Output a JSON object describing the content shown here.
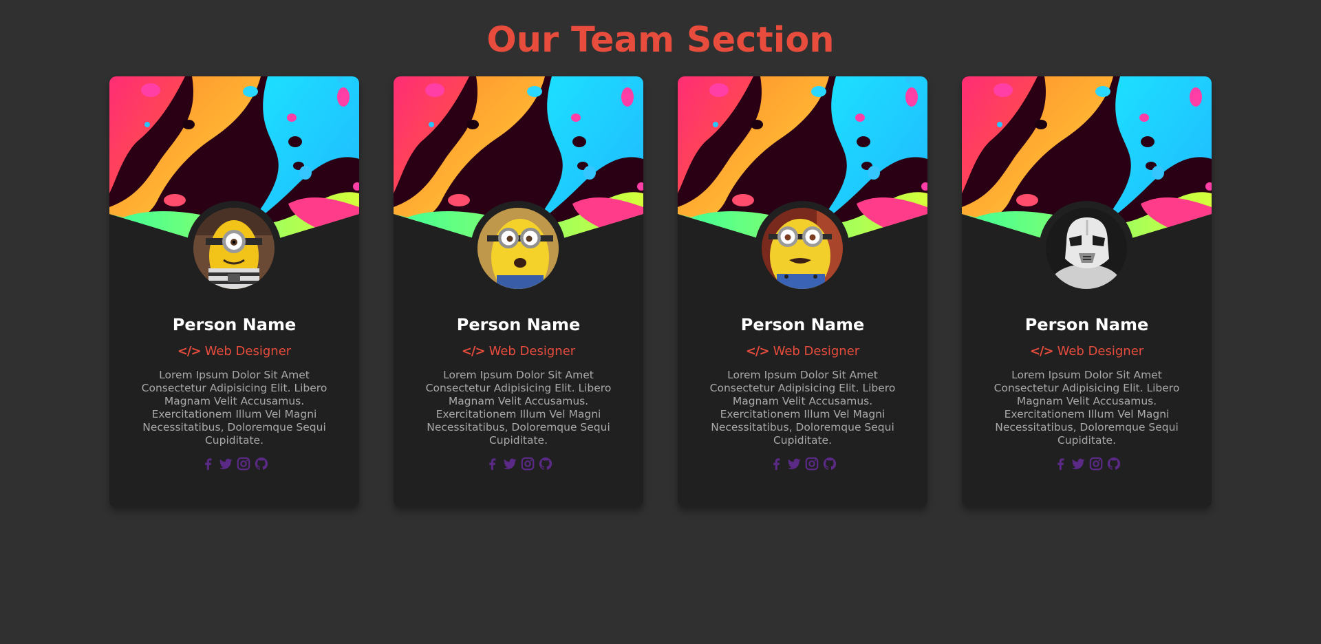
{
  "page": {
    "title": "Our Team Section"
  },
  "colors": {
    "background": "#303030",
    "card_background": "#202020",
    "accent": "#e74c3c",
    "social_icon": "#5b2a86",
    "name_text": "#ffffff",
    "bio_text": "#a9a9a9"
  },
  "cards": [
    {
      "name": "Person Name",
      "role": "Web Designer",
      "role_icon": "code-icon",
      "bio": "Lorem Ipsum Dolor Sit Amet Consectetur Adipisicing Elit. Libero Magnam Velit Accusamus. Exercitationem Illum Vel Magni Necessitatibus, Doloremque Sequi Cupiditate.",
      "avatar": "minion-one-eye-avatar",
      "socials": [
        "facebook-icon",
        "twitter-icon",
        "instagram-icon",
        "github-icon"
      ]
    },
    {
      "name": "Person Name",
      "role": "Web Designer",
      "role_icon": "code-icon",
      "bio": "Lorem Ipsum Dolor Sit Amet Consectetur Adipisicing Elit. Libero Magnam Velit Accusamus. Exercitationem Illum Vel Magni Necessitatibus, Doloremque Sequi Cupiditate.",
      "avatar": "minion-two-eyes-avatar",
      "socials": [
        "facebook-icon",
        "twitter-icon",
        "instagram-icon",
        "github-icon"
      ]
    },
    {
      "name": "Person Name",
      "role": "Web Designer",
      "role_icon": "code-icon",
      "bio": "Lorem Ipsum Dolor Sit Amet Consectetur Adipisicing Elit. Libero Magnam Velit Accusamus. Exercitationem Illum Vel Magni Necessitatibus, Doloremque Sequi Cupiditate.",
      "avatar": "minion-surprised-avatar",
      "socials": [
        "facebook-icon",
        "twitter-icon",
        "instagram-icon",
        "github-icon"
      ]
    },
    {
      "name": "Person Name",
      "role": "Web Designer",
      "role_icon": "code-icon",
      "bio": "Lorem Ipsum Dolor Sit Amet Consectetur Adipisicing Elit. Libero Magnam Velit Accusamus. Exercitationem Illum Vel Magni Necessitatibus, Doloremque Sequi Cupiditate.",
      "avatar": "stormtrooper-avatar",
      "socials": [
        "facebook-icon",
        "twitter-icon",
        "instagram-icon",
        "github-icon"
      ]
    }
  ]
}
